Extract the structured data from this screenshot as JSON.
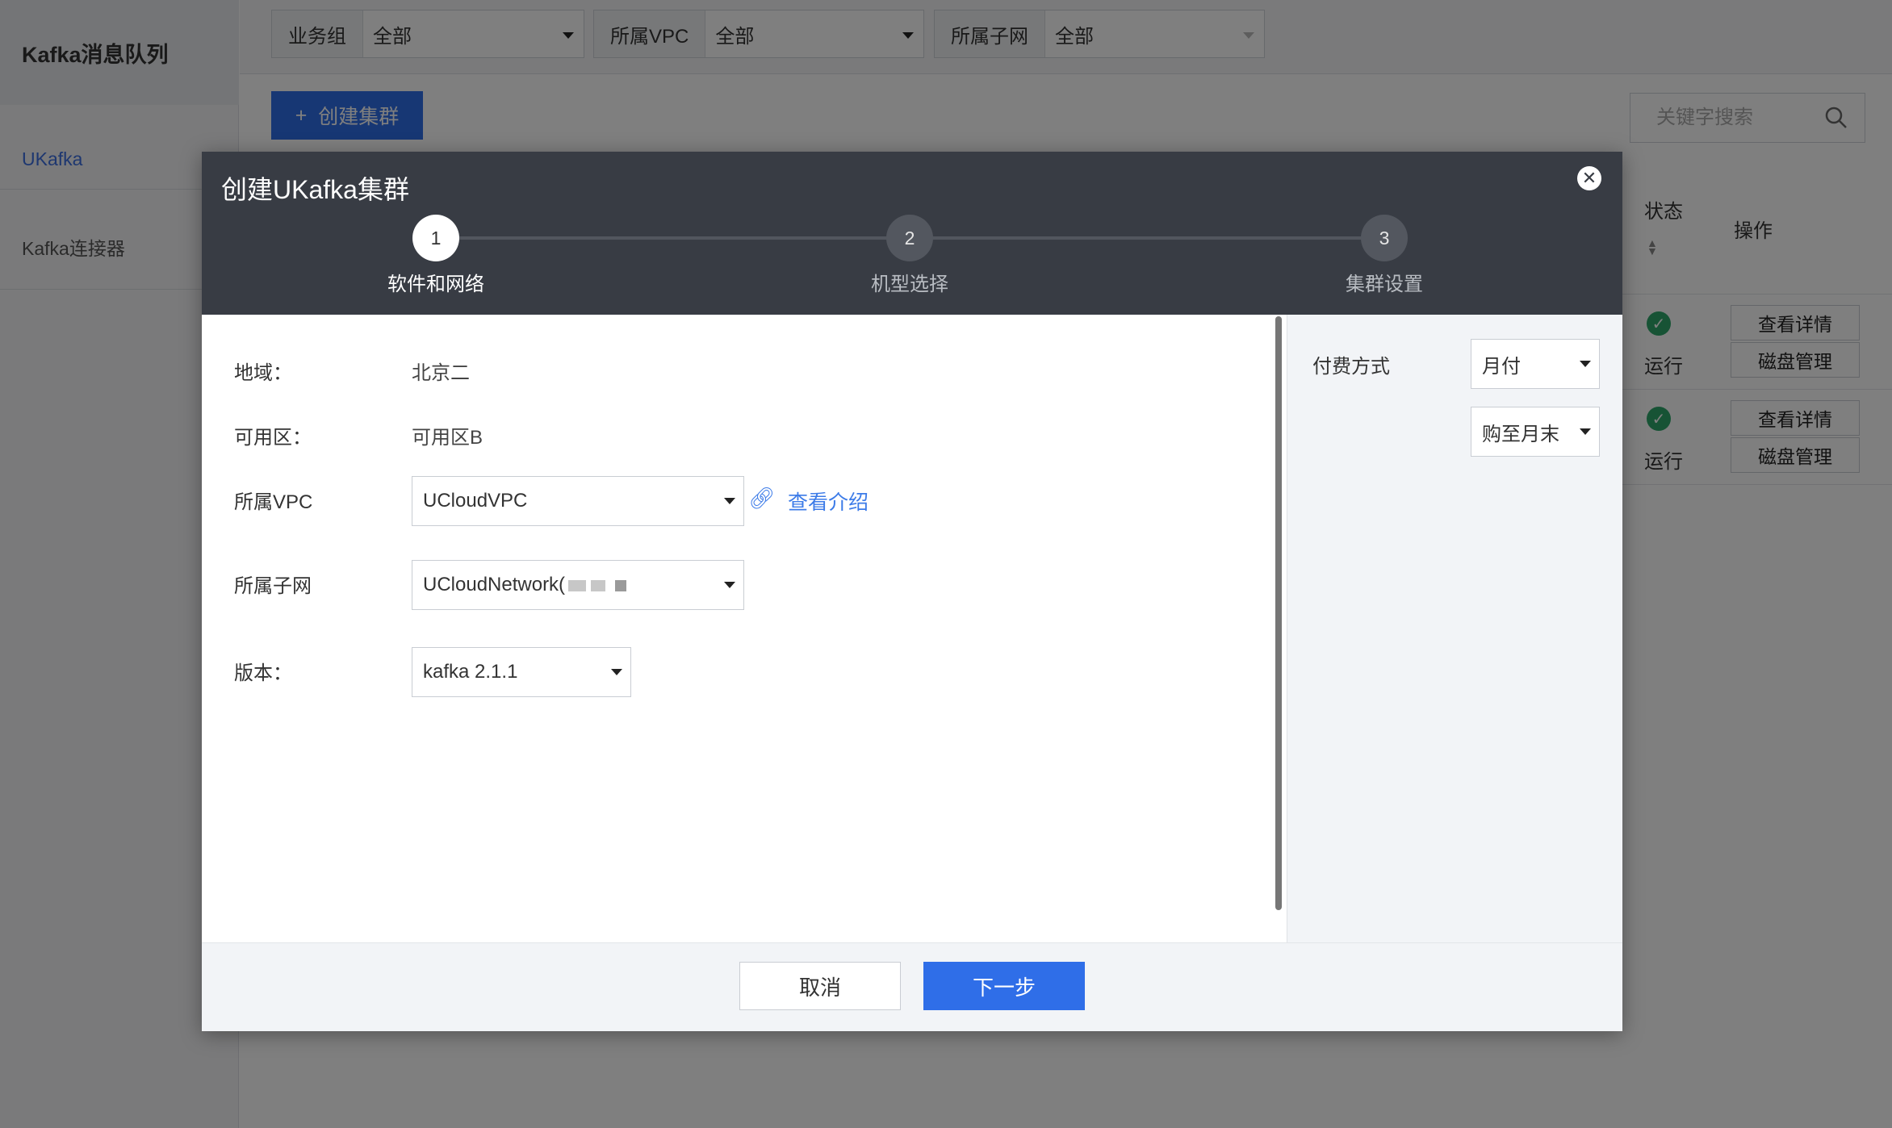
{
  "sidebar": {
    "title": "Kafka消息队列",
    "items": [
      {
        "label": "UKafka"
      },
      {
        "label": "Kafka连接器"
      }
    ]
  },
  "filters": [
    {
      "label": "业务组",
      "value": "全部"
    },
    {
      "label": "所属VPC",
      "value": "全部"
    },
    {
      "label": "所属子网",
      "value": "全部"
    }
  ],
  "toolbar": {
    "create_label": "创建集群",
    "search_placeholder": "关键字搜索"
  },
  "table": {
    "columns": {
      "status": "状态",
      "actions": "操作"
    },
    "rows": [
      {
        "status": "运行",
        "actions": [
          "查看详情",
          "磁盘管理"
        ]
      },
      {
        "status": "运行",
        "actions": [
          "查看详情",
          "磁盘管理"
        ]
      }
    ]
  },
  "modal": {
    "title": "创建UKafka集群",
    "steps": [
      {
        "number": "1",
        "label": "软件和网络"
      },
      {
        "number": "2",
        "label": "机型选择"
      },
      {
        "number": "3",
        "label": "集群设置"
      }
    ],
    "form": {
      "region_label": "地域：",
      "region_value": "北京二",
      "zone_label": "可用区：",
      "zone_value": "可用区B",
      "vpc_label": "所属VPC",
      "vpc_value": "UCloudVPC",
      "vpc_link": "查看介绍",
      "subnet_label": "所属子网",
      "subnet_value": "UCloudNetwork(",
      "version_label": "版本：",
      "version_value": "kafka 2.1.1"
    },
    "billing": {
      "label": "付费方式",
      "mode": "月付",
      "duration": "购至月末"
    },
    "footer": {
      "cancel": "取消",
      "next": "下一步"
    }
  },
  "colors": {
    "primary": "#2f6ee8",
    "header": "#383c44",
    "success": "#2ea76b",
    "link": "#3c7be8"
  }
}
